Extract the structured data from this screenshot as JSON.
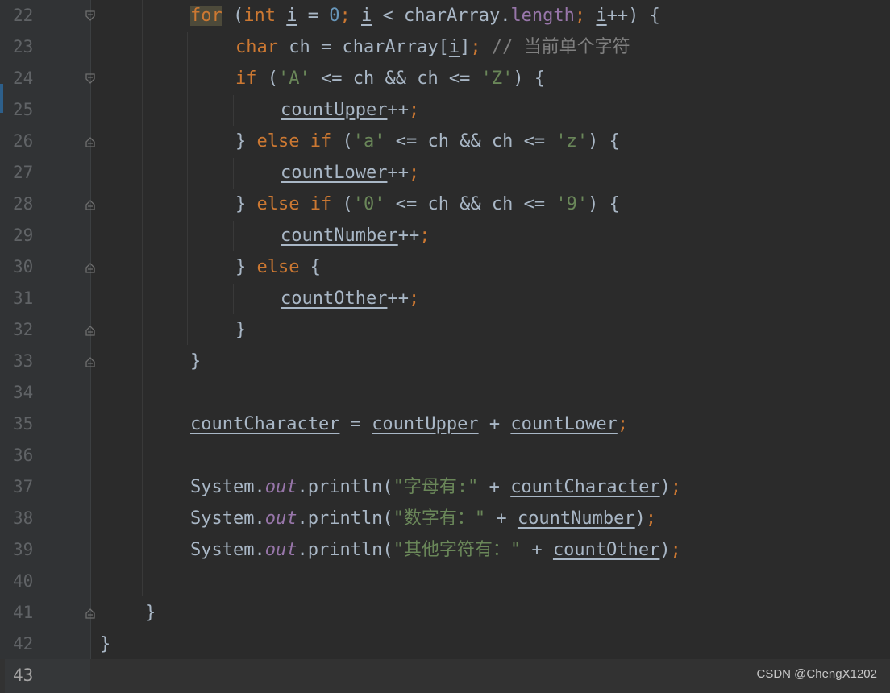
{
  "editor": {
    "line_numbers": [
      "22",
      "23",
      "24",
      "25",
      "26",
      "27",
      "28",
      "29",
      "30",
      "31",
      "32",
      "33",
      "34",
      "35",
      "36",
      "37",
      "38",
      "39",
      "40",
      "41",
      "42",
      "43"
    ],
    "current_line": "43",
    "lines": {
      "l22": [
        "for",
        " (",
        "int",
        " ",
        "i",
        " = ",
        "0",
        "; ",
        "i",
        " < charArray.",
        "length",
        "; ",
        "i",
        "++) {"
      ],
      "l23": [
        "char",
        " ch = charArray[",
        "i",
        "]",
        "; ",
        "// 当前单个字符"
      ],
      "l24": [
        "if",
        " (",
        "'A'",
        " <= ch && ch <= ",
        "'Z'",
        ") {"
      ],
      "l25": [
        "countUpper",
        "++",
        ";"
      ],
      "l26": [
        "} ",
        "else if",
        " (",
        "'a'",
        " <= ch && ch <= ",
        "'z'",
        ") {"
      ],
      "l27": [
        "countLower",
        "++",
        ";"
      ],
      "l28": [
        "} ",
        "else if",
        " (",
        "'0'",
        " <= ch && ch <= ",
        "'9'",
        ") {"
      ],
      "l29": [
        "countNumber",
        "++",
        ";"
      ],
      "l30": [
        "} ",
        "else",
        " {"
      ],
      "l31": [
        "countOther",
        "++",
        ";"
      ],
      "l32": [
        "}"
      ],
      "l33": [
        "}"
      ],
      "l35": [
        "countCharacter",
        " = ",
        "countUpper",
        " + ",
        "countLower",
        ";"
      ],
      "l37": [
        "System.",
        "out",
        ".println(",
        "\"字母有:\"",
        " + ",
        "countCharacter",
        ")",
        ";"
      ],
      "l38": [
        "System.",
        "out",
        ".println(",
        "\"数字有：\"",
        " + ",
        "countNumber",
        ")",
        ";"
      ],
      "l39": [
        "System.",
        "out",
        ".println(",
        "\"其他字符有：\"",
        " + ",
        "countOther",
        ")",
        ";"
      ],
      "l41": [
        "}"
      ],
      "l42": [
        "}"
      ]
    }
  },
  "watermark": "CSDN @ChengX1202",
  "colors": {
    "background": "#2b2b2b",
    "keyword": "#cc7832",
    "number": "#6897bb",
    "string": "#6a8759",
    "comment": "#808080",
    "field": "#9876aa",
    "default_text": "#a9b7c6"
  }
}
